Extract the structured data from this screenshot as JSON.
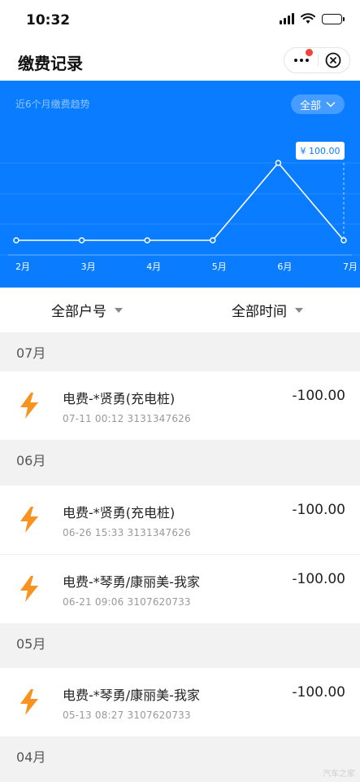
{
  "status_bar": {
    "time": "10:32"
  },
  "nav": {
    "title": "缴费记录"
  },
  "chart_section": {
    "caption": "近6个月缴费趋势",
    "filter_label": "全部",
    "tooltip": "¥ 100.00"
  },
  "chart_data": {
    "type": "line",
    "categories": [
      "2月",
      "3月",
      "4月",
      "5月",
      "6月",
      "7月"
    ],
    "values": [
      0,
      0,
      0,
      0,
      100,
      0
    ],
    "title": "",
    "xlabel": "",
    "ylabel": "",
    "ylim": [
      0,
      100
    ],
    "grid": true,
    "highlight": {
      "category": "6月",
      "label": "¥ 100.00"
    },
    "colors": {
      "background": "#0a7cff",
      "line": "#ffffff"
    }
  },
  "filters": {
    "account": "全部户号",
    "time": "全部时间"
  },
  "groups": [
    {
      "month": "07月",
      "records": [
        {
          "name": "电费-*贤勇(充电桩)",
          "meta": "07-11 00:12 3131347626",
          "amount": "-100.00"
        }
      ]
    },
    {
      "month": "06月",
      "records": [
        {
          "name": "电费-*贤勇(充电桩)",
          "meta": "06-26 15:33 3131347626",
          "amount": "-100.00"
        },
        {
          "name": "电费-*琴勇/康丽美-我家",
          "meta": "06-21 09:06 3107620733",
          "amount": "-100.00"
        }
      ]
    },
    {
      "month": "05月",
      "records": [
        {
          "name": "电费-*琴勇/康丽美-我家",
          "meta": "05-13 08:27 3107620733",
          "amount": "-100.00"
        }
      ]
    },
    {
      "month": "04月",
      "records": []
    }
  ],
  "icons": {
    "record_icon": "lightning-bolt-icon",
    "bolt_color": "#f7931e"
  },
  "watermark": "汽车之家"
}
